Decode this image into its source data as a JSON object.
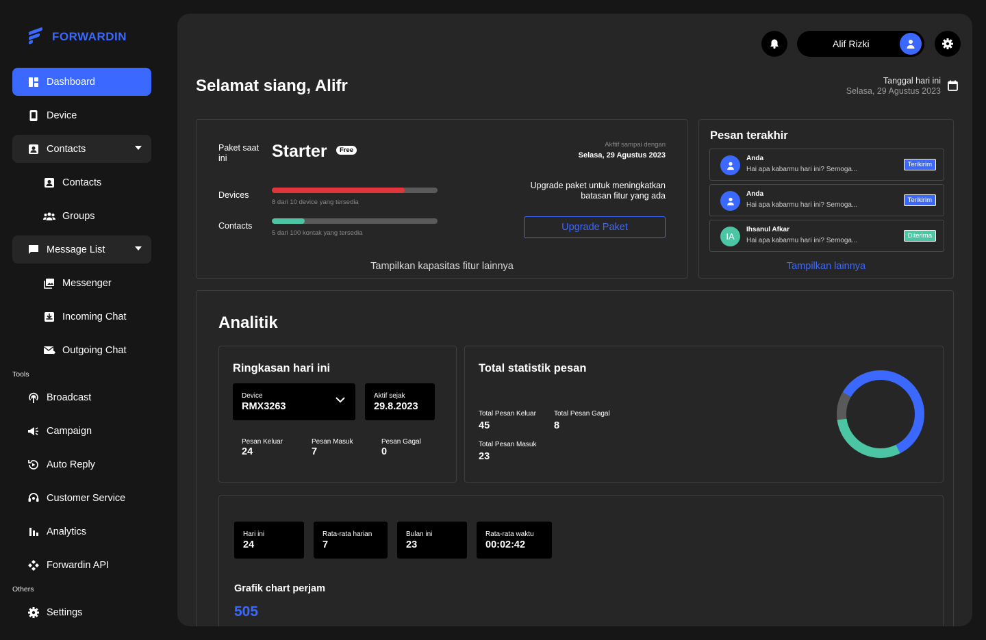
{
  "brand": {
    "name": "FORWARDIN",
    "color": "#3b68ff"
  },
  "sidebar": {
    "items": [
      {
        "label": "Dashboard",
        "icon": "dashboard-icon"
      },
      {
        "label": "Device",
        "icon": "device-icon"
      },
      {
        "label": "Contacts",
        "icon": "contacts-icon"
      },
      {
        "label": "Contacts",
        "icon": "contact-card-icon"
      },
      {
        "label": "Groups",
        "icon": "groups-icon"
      },
      {
        "label": "Message List",
        "icon": "message-icon"
      },
      {
        "label": "Messenger",
        "icon": "messenger-icon"
      },
      {
        "label": "Incoming Chat",
        "icon": "inbox-icon"
      },
      {
        "label": "Outgoing Chat",
        "icon": "outbox-icon"
      }
    ],
    "tools_label": "Tools",
    "tools": [
      {
        "label": "Broadcast",
        "icon": "broadcast-icon"
      },
      {
        "label": "Campaign",
        "icon": "campaign-icon"
      },
      {
        "label": "Auto Reply",
        "icon": "auto-reply-icon"
      },
      {
        "label": "Customer Service",
        "icon": "support-icon"
      },
      {
        "label": "Analytics",
        "icon": "analytics-icon"
      },
      {
        "label": "Forwardin API",
        "icon": "api-icon"
      }
    ],
    "others_label": "Others",
    "others": [
      {
        "label": "Settings",
        "icon": "gear-icon"
      }
    ]
  },
  "header": {
    "user_name": "Alif Rizki",
    "greeting": "Selamat siang, Alifr",
    "date_label": "Tanggal hari ini",
    "date_value": "Selasa, 29 Agustus 2023"
  },
  "package": {
    "label": "Paket saat ini",
    "name": "Starter",
    "badge": "Free",
    "active_until_label": "Akftif sampai dengan",
    "active_until_date": "Selasa, 29 Agustus 2023",
    "devices_label": "Devices",
    "devices_note": "8 dari 10 device yang tersedia",
    "devices_used": 8,
    "devices_total": 10,
    "contacts_label": "Contacts",
    "contacts_note": "5 dari 100 kontak yang tersedia",
    "contacts_used": 5,
    "contacts_total": 100,
    "upgrade_text": "Upgrade paket untuk meningkatkan batasan fitur yang ada",
    "upgrade_button": "Upgrade Paket",
    "show_more": "Tampilkan kapasitas fitur lainnya",
    "colors": {
      "devices": "#e0353b",
      "contacts": "#4bc5a3"
    }
  },
  "messages": {
    "title": "Pesan terakhir",
    "items": [
      {
        "name": "Anda",
        "text": "Hai apa kabarmu hari ini? Semoga...",
        "status": "Terikirim",
        "status_color": "#3b68ff",
        "avatar": ""
      },
      {
        "name": "Anda",
        "text": "Hai apa kabarmu hari ini? Semoga...",
        "status": "Terikirim",
        "status_color": "#3b68ff",
        "avatar": ""
      },
      {
        "name": "Ihsanul Afkar",
        "text": "Hai apa kabarmu hari ini? Semoga...",
        "status": "Diterima",
        "status_color": "#4bc5a3",
        "avatar": "IA"
      }
    ],
    "show_more": "Tampilkan lainnya"
  },
  "analytics": {
    "title": "Analitik",
    "summary": {
      "title": "Ringkasan hari ini",
      "device_label": "Device",
      "device_value": "RMX3263",
      "active_label": "Aktif sejak",
      "active_value": "29.8.2023",
      "stats": [
        {
          "label": "Pesan Keluar",
          "value": "24"
        },
        {
          "label": "Pesan Masuk",
          "value": "7"
        },
        {
          "label": "Pesan Gagal",
          "value": "0"
        }
      ]
    },
    "totals": {
      "title": "Total statistik pesan",
      "stats": [
        {
          "label": "Total Pesan Keluar",
          "value": "45"
        },
        {
          "label": "Total Pesan Gagal",
          "value": "8"
        },
        {
          "label": "Total Pesan Masuk",
          "value": "23"
        }
      ],
      "donut": [
        {
          "value": 45,
          "color": "#3b68ff"
        },
        {
          "value": 23,
          "color": "#4bc5a3"
        },
        {
          "value": 8,
          "color": "#5a5a5a"
        }
      ]
    },
    "hourly": {
      "boxes": [
        {
          "label": "Hari ini",
          "value": "24"
        },
        {
          "label": "Rata-rata harian",
          "value": "7"
        },
        {
          "label": "Bulan ini",
          "value": "23"
        },
        {
          "label": "Rata-rata waktu",
          "value": "00:02:42"
        }
      ],
      "chart_title": "Grafik chart perjam",
      "chart_total": "505"
    }
  }
}
